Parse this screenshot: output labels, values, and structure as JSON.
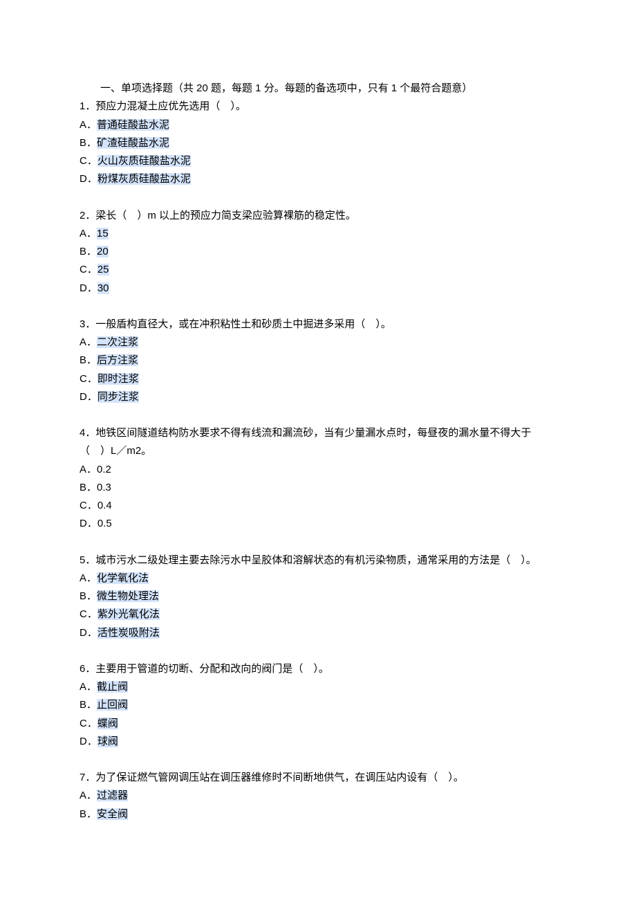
{
  "sectionHeader": "一、单项选择题（共 20 题，每题 1 分。每题的备选项中，只有 1 个最符合题意）",
  "questions": [
    {
      "num": "1",
      "text": "预应力混凝土应优先选用（　）。",
      "options": [
        {
          "label": "A",
          "text": "普通硅酸盐水泥"
        },
        {
          "label": "B",
          "text": "矿渣硅酸盐水泥"
        },
        {
          "label": "C",
          "text": "火山灰质硅酸盐水泥"
        },
        {
          "label": "D",
          "text": "粉煤灰质硅酸盐水泥"
        }
      ],
      "highlight": true
    },
    {
      "num": "2",
      "text": "梁长（　）m 以上的预应力简支梁应验算裸筋的稳定性。",
      "options": [
        {
          "label": "A",
          "text": "15"
        },
        {
          "label": "B",
          "text": "20"
        },
        {
          "label": "C",
          "text": "25"
        },
        {
          "label": "D",
          "text": "30"
        }
      ],
      "highlight": true
    },
    {
      "num": "3",
      "text": "一般盾构直径大，或在冲积粘性土和砂质土中掘进多采用（　）。",
      "options": [
        {
          "label": "A",
          "text": "二次注浆"
        },
        {
          "label": "B",
          "text": "后方注浆"
        },
        {
          "label": "C",
          "text": "即时注浆"
        },
        {
          "label": "D",
          "text": "同步注浆"
        }
      ],
      "highlight": true
    },
    {
      "num": "4",
      "text": "地铁区间隧道结构防水要求不得有线流和漏流砂，当有少量漏水点时，每昼夜的漏水量不得大于（　）L／m2。",
      "options": [
        {
          "label": "A",
          "text": "0.2"
        },
        {
          "label": "B",
          "text": "0.3"
        },
        {
          "label": "C",
          "text": "0.4"
        },
        {
          "label": "D",
          "text": "0.5"
        }
      ],
      "highlight": false
    },
    {
      "num": "5",
      "text": "城市污水二级处理主要去除污水中呈胶体和溶解状态的有机污染物质，通常采用的方法是（　）。",
      "options": [
        {
          "label": "A",
          "text": "化学氧化法"
        },
        {
          "label": "B",
          "text": "微生物处理法"
        },
        {
          "label": "C",
          "text": "紫外光氧化法"
        },
        {
          "label": "D",
          "text": "活性炭吸附法"
        }
      ],
      "highlight": true
    },
    {
      "num": "6",
      "text": "主要用于管道的切断、分配和改向的阀门是（　）。",
      "options": [
        {
          "label": "A",
          "text": "截止阀"
        },
        {
          "label": "B",
          "text": "止回阀"
        },
        {
          "label": "C",
          "text": "蝶阀"
        },
        {
          "label": "D",
          "text": "球阀"
        }
      ],
      "highlight": true
    },
    {
      "num": "7",
      "text": "为了保证燃气管网调压站在调压器维修时不间断地供气，在调压站内设有（　）。",
      "options": [
        {
          "label": "A",
          "text": "过滤器"
        },
        {
          "label": "B",
          "text": "安全阀"
        }
      ],
      "highlight": true
    }
  ]
}
